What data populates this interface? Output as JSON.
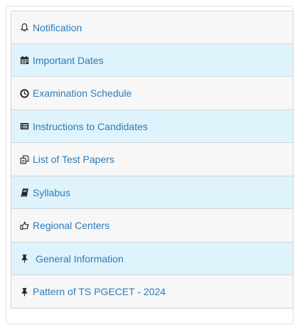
{
  "menu": {
    "items": [
      {
        "label": "Notification",
        "icon": "bell-icon"
      },
      {
        "label": "Important Dates",
        "icon": "calendar-icon"
      },
      {
        "label": "Examination Schedule",
        "icon": "clock-icon"
      },
      {
        "label": "Instructions to Candidates",
        "icon": "list-alt-icon"
      },
      {
        "label": "List of Test Papers",
        "icon": "copy-icon"
      },
      {
        "label": "Syllabus",
        "icon": "book-icon"
      },
      {
        "label": "Regional Centers",
        "icon": "hand-pointer-icon"
      },
      {
        "label": "General Information",
        "icon": "pushpin-icon"
      },
      {
        "label": "Pattern of TS PGECET - 2024",
        "icon": "pushpin-icon"
      }
    ]
  },
  "colors": {
    "link": "#2d7bb8",
    "row_alt": "#dff3fc",
    "row": "#f7f7f7",
    "border": "#d4d4d4"
  }
}
